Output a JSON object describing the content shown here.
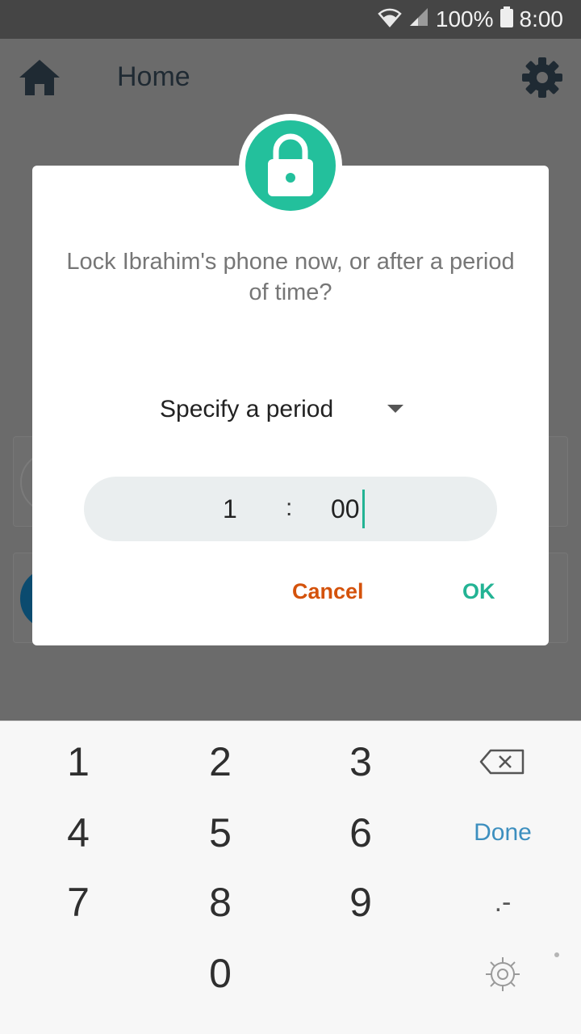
{
  "status_bar": {
    "battery": "100%",
    "time": "8:00"
  },
  "app_bar": {
    "title": "Home"
  },
  "dialog": {
    "message": "Lock Ibrahim's phone now, or after a period of time?",
    "period_option": "Specify a period",
    "time": {
      "hours": "1",
      "separator": ":",
      "minutes": "00"
    },
    "cancel_label": "Cancel",
    "ok_label": "OK"
  },
  "keypad": {
    "digits": [
      "1",
      "2",
      "3",
      "4",
      "5",
      "6",
      "7",
      "8",
      "9",
      "0"
    ],
    "done_label": "Done",
    "punct_label": ".-"
  },
  "colors": {
    "accent": "#23c09c",
    "cancel": "#d4520b",
    "done": "#3d8fbf"
  }
}
